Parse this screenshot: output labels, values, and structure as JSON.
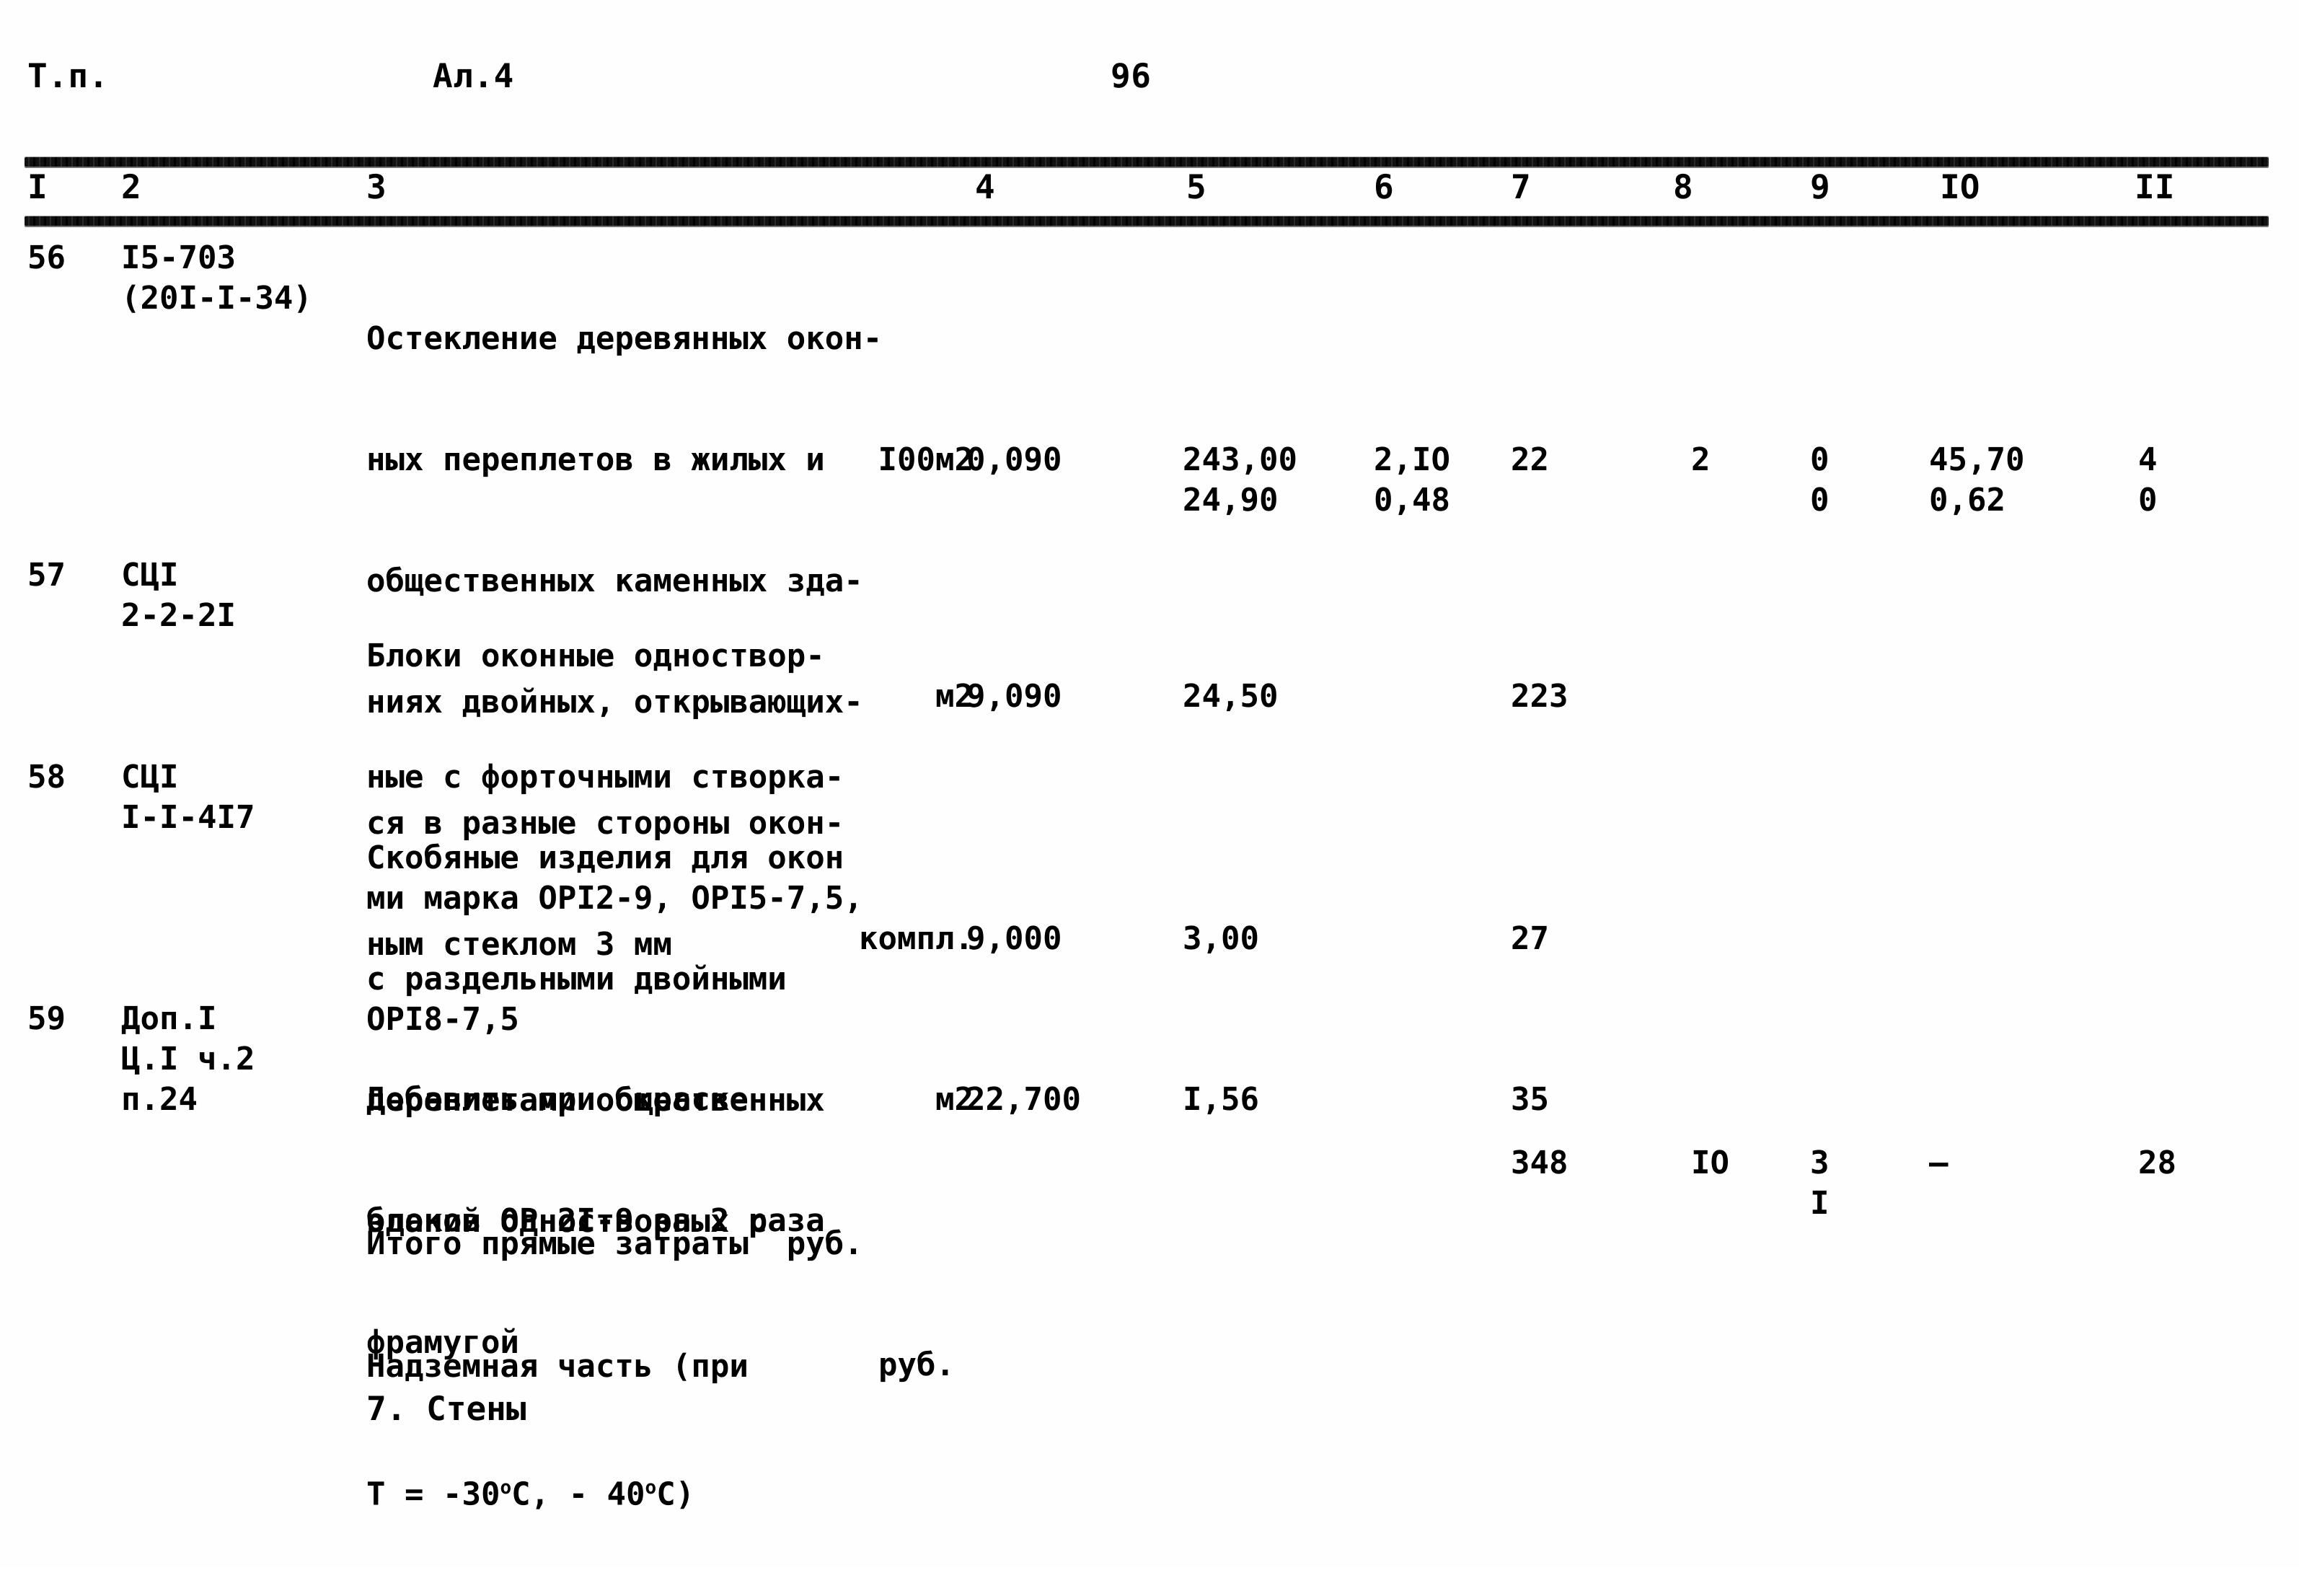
{
  "header": {
    "left_label": "Т.п.",
    "sheet_label": "Ал.4",
    "page_number": "96"
  },
  "table": {
    "column_headers": [
      "I",
      "2",
      "3",
      "4",
      "5",
      "6",
      "7",
      "8",
      "9",
      "IO",
      "II"
    ],
    "rows": [
      {
        "num": "56",
        "code_line1": "I5-703",
        "code_line2": "(20I-I-34)",
        "desc_lines": [
          "Остекление деревянных окон-",
          "ных переплетов в жилых и",
          "общественных каменных зда-",
          "ниях двойных, открывающих-",
          "ся в разные стороны окон-",
          "ным стеклом 3 мм"
        ],
        "unit": "I00м2",
        "c4": "0,090",
        "c5_line1": "243,00",
        "c5_line2": "24,90",
        "c6_line1": "2,IO",
        "c6_line2": "0,48",
        "c7": "22",
        "c8": "2",
        "c9_line1": "0",
        "c9_line2": "0",
        "c10_line1": "45,70",
        "c10_line2": "0,62",
        "c11_line1": "4",
        "c11_line2": "0"
      },
      {
        "num": "57",
        "code_line1": "СЦI",
        "code_line2": "2-2-2I",
        "desc_lines": [
          "Блоки оконные одноствор-",
          "ные с форточными створка-",
          "ми марка ОРI2-9, ОРI5-7,5,",
          "ОРI8-7,5"
        ],
        "unit": "м2",
        "c4": "9,090",
        "c5_line1": "24,50",
        "c7": "223"
      },
      {
        "num": "58",
        "code_line1": "СЦI",
        "code_line2": "I-I-4I7",
        "desc_lines": [
          "Скобяные изделия для окон",
          "с раздельными двойными",
          "переплетами общественных",
          "зданий одностворных с",
          "фрамугой"
        ],
        "unit": "компл.",
        "c4": "9,000",
        "c5_line1": "3,00",
        "c7": "27"
      },
      {
        "num": "59",
        "code_line1": "Доп.I",
        "code_line2": "Ц.I ч.2",
        "code_line3": "п.24",
        "desc_lines": [
          "Добавить при окраске",
          "блоков ОР 2I-9 за 2 раза"
        ],
        "unit": "м2",
        "c4": "22,700",
        "c5_line1": "I,56",
        "c7": "35"
      }
    ],
    "total_row": {
      "label": "Итого прямые затраты  руб.",
      "label_line2": "руб.",
      "c7": "348",
      "c8": "IO",
      "c9_line1": "3",
      "c9_line2": "I",
      "c10": "–",
      "c11": "28"
    }
  },
  "notes": {
    "section_note_line1": "Надземная часть (при",
    "section_note_line2_pre": "Т = -30",
    "section_note_line2_deg1": "o",
    "section_note_line2_mid": "С, - 40",
    "section_note_line2_deg2": "o",
    "section_note_line2_post": "С)",
    "section_title": "7. Стены"
  }
}
